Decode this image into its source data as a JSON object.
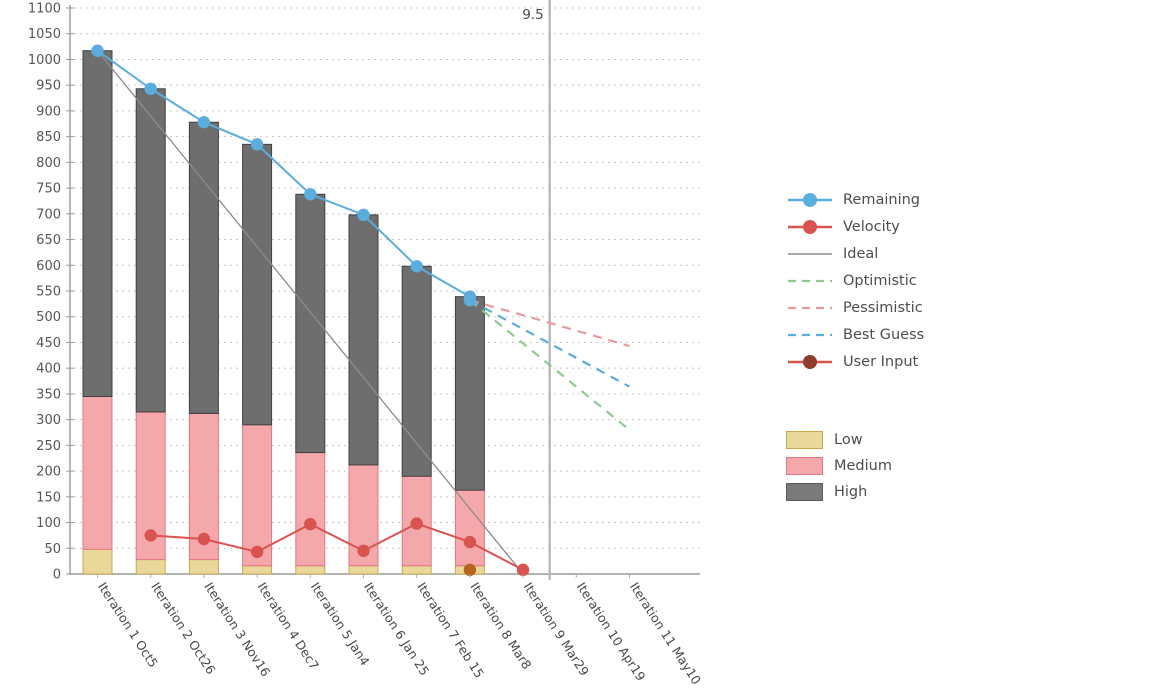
{
  "chart_data": {
    "type": "bar",
    "title": "",
    "xlabel": "",
    "ylabel": "",
    "ylim": [
      0,
      1100
    ],
    "ytick_step": 50,
    "grid": true,
    "legend_position": "right",
    "categories": [
      "Iteration 1 Oct5",
      "Iteration 2 Oct26",
      "Iteration 3 Nov16",
      "Iteration 4 Dec7",
      "Iteration 5 Jan4",
      "Iteration 6 Jan 25",
      "Iteration 7 Feb 15",
      "Iteration 8 Mar8",
      "Iteration 9 Mar29",
      "Iteration 10 Apr19",
      "Iteration 11 May10"
    ],
    "ytick_labels": [
      "1100",
      "1050",
      "1000",
      "950",
      "900",
      "850",
      "800",
      "750",
      "700",
      "650",
      "600",
      "550",
      "500",
      "450",
      "400",
      "350",
      "300",
      "250",
      "200",
      "150",
      "100",
      "50",
      "0"
    ],
    "stacked_series": [
      {
        "name": "Low",
        "color": "#ead89a",
        "border": "#c9a94e",
        "values": [
          48,
          28,
          28,
          16,
          16,
          16,
          16,
          16,
          null,
          null,
          null
        ]
      },
      {
        "name": "Medium",
        "color": "#f5a8ab",
        "border": "#e0797d",
        "values": [
          297,
          287,
          284,
          274,
          220,
          196,
          174,
          147,
          null,
          null,
          null
        ]
      },
      {
        "name": "High",
        "color": "#6e6e6e",
        "border": "#3f3f3f",
        "values": [
          672,
          628,
          566,
          545,
          502,
          486,
          408,
          376,
          null,
          null,
          null
        ]
      }
    ],
    "stack_totals": [
      1017,
      943,
      878,
      835,
      738,
      698,
      598,
      539,
      null,
      null,
      null
    ],
    "line_series": [
      {
        "name": "Remaining",
        "color": "#5aaddc",
        "style": "solid",
        "marker": "circle",
        "values": [
          1017,
          943,
          878,
          835,
          738,
          698,
          598,
          539,
          null,
          null,
          null
        ]
      },
      {
        "name": "Velocity",
        "color": "#d9534f",
        "style": "solid",
        "marker": "circle",
        "values": [
          null,
          75,
          68,
          43,
          97,
          45,
          98,
          62,
          8,
          null,
          null
        ]
      },
      {
        "name": "Ideal",
        "color": "#8c8c8c",
        "style": "solid",
        "marker": "none",
        "values": [
          1017,
          890,
          763,
          636,
          509,
          382,
          254,
          127,
          0,
          null,
          null
        ]
      },
      {
        "name": "Optimistic",
        "color": "#8fc98f",
        "style": "dashed",
        "marker": "none",
        "values": [
          null,
          null,
          null,
          null,
          null,
          null,
          null,
          532,
          448,
          364,
          280
        ]
      },
      {
        "name": "Pessimistic",
        "color": "#e79a9d",
        "style": "dashed",
        "marker": "none",
        "values": [
          null,
          null,
          null,
          null,
          null,
          null,
          null,
          532,
          503,
          473,
          443
        ]
      },
      {
        "name": "Best Guess",
        "color": "#5aaddc",
        "style": "dashed",
        "marker": "none",
        "values": [
          null,
          null,
          null,
          null,
          null,
          null,
          null,
          532,
          476,
          420,
          364
        ]
      },
      {
        "name": "User Input",
        "color": "#b5651d",
        "style": "solid",
        "marker": "circle",
        "values": [
          null,
          null,
          null,
          null,
          null,
          null,
          null,
          8,
          null,
          null,
          null
        ]
      }
    ],
    "remaining_last_point": 532,
    "vertical_marker": {
      "label": "9.5",
      "x_value": 9.5,
      "color": "#b9b9b9"
    }
  },
  "legend": {
    "series_items": [
      {
        "label": "Remaining",
        "color": "#5aaddc",
        "style": "solid",
        "marker": "circle",
        "icon": "line-marker-icon"
      },
      {
        "label": "Velocity",
        "color": "#d9534f",
        "style": "solid",
        "marker": "circle",
        "icon": "line-marker-icon"
      },
      {
        "label": "Ideal",
        "color": "#8c8c8c",
        "style": "solid",
        "marker": "none",
        "icon": "line-icon"
      },
      {
        "label": "Optimistic",
        "color": "#8fc98f",
        "style": "dashed",
        "marker": "none",
        "icon": "dashed-line-icon"
      },
      {
        "label": "Pessimistic",
        "color": "#e79a9d",
        "style": "dashed",
        "marker": "none",
        "icon": "dashed-line-icon"
      },
      {
        "label": "Best Guess",
        "color": "#5aaddc",
        "style": "dashed",
        "marker": "none",
        "icon": "dashed-line-icon"
      },
      {
        "label": "User Input",
        "color": "#8e3b2e",
        "lineColor": "#d9534f",
        "style": "solid",
        "marker": "circle",
        "icon": "line-marker-icon"
      }
    ],
    "stack_items": [
      {
        "label": "Low",
        "color": "#ead89a",
        "border": "#c9a94e",
        "icon": "swatch-icon"
      },
      {
        "label": "Medium",
        "color": "#f5a8ab",
        "border": "#e0797d",
        "icon": "swatch-icon"
      },
      {
        "label": "High",
        "color": "#7a7a7a",
        "border": "#5a5a5a",
        "icon": "swatch-icon"
      }
    ]
  }
}
